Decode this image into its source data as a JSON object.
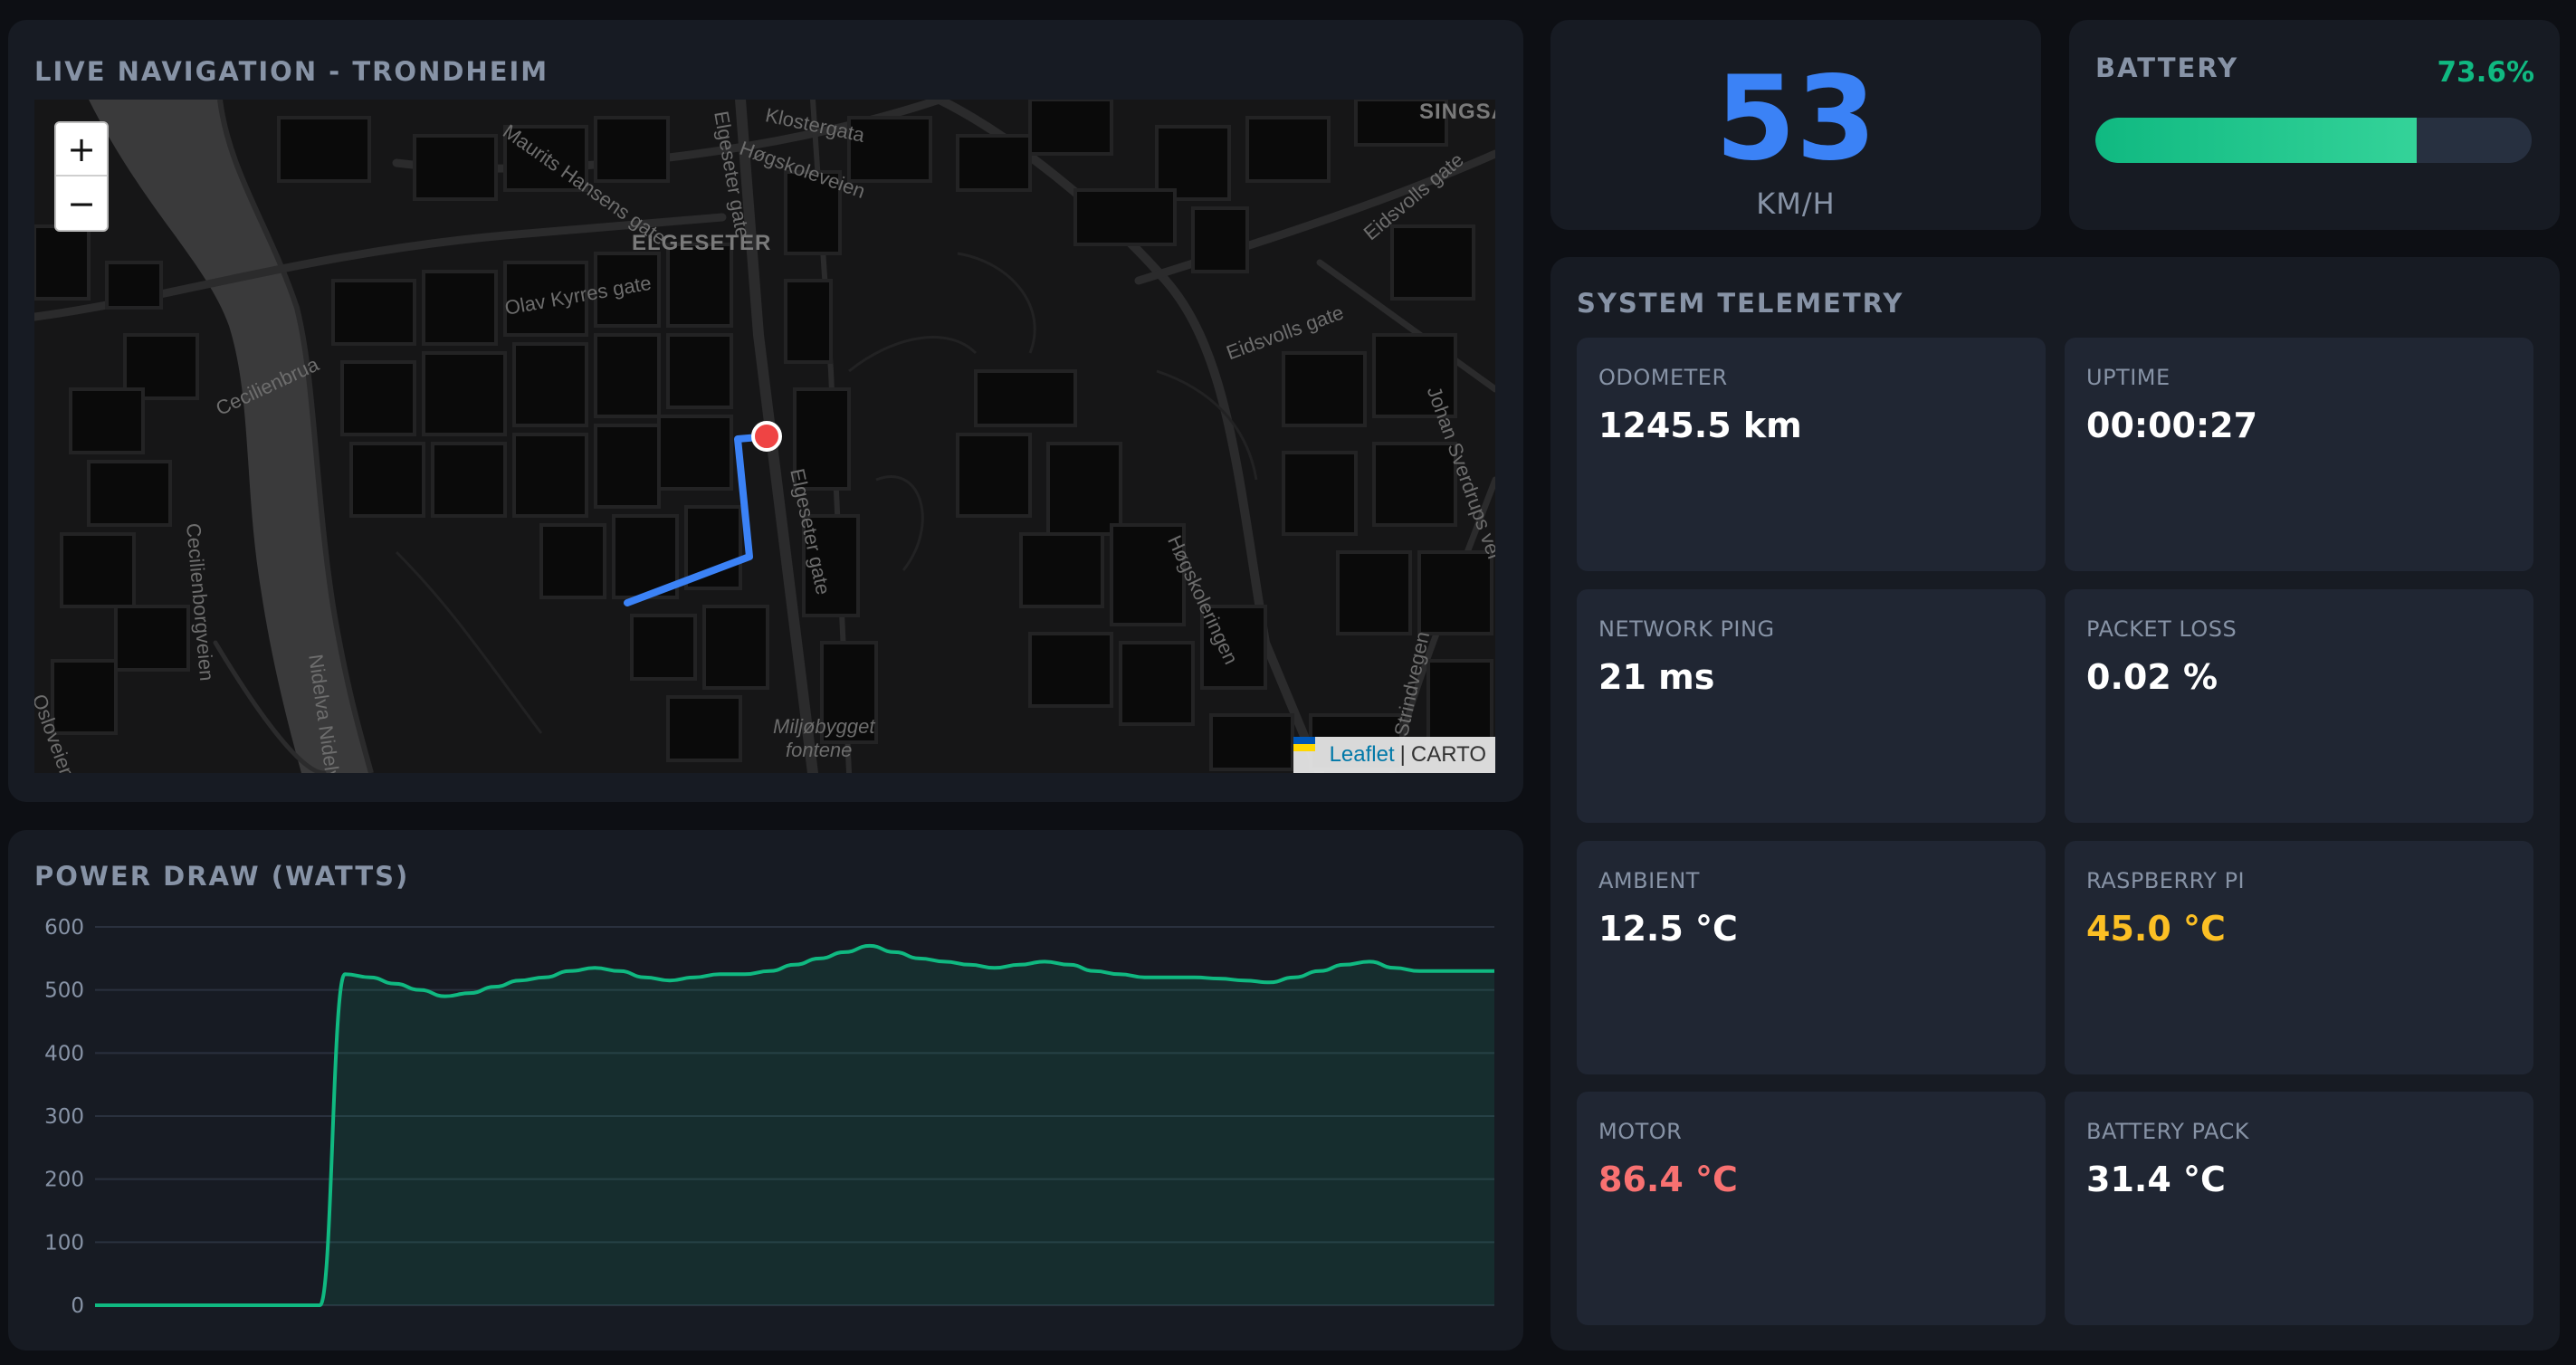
{
  "map": {
    "title": "LIVE NAVIGATION - TRONDHEIM",
    "zoom_in": "+",
    "zoom_out": "−",
    "attribution_link": "Leaflet",
    "attribution_sep": "|",
    "attribution_provider": "CARTO",
    "labels": {
      "elgeseter": "ELGESETER",
      "singsaker": "SINGSA",
      "klostergata": "Klostergata",
      "hogskoleveien": "Høgskoleveien",
      "maurits": "Maurits Hansens gate",
      "elgeseter_gate_top": "Elgeseter gate",
      "elgeseter_gate": "Elgeseter gate",
      "olav": "Olav Kyrres gate",
      "cecilie": "Cecilienbrua",
      "cecilie_vei": "Cecilienborgveien",
      "eidsvolls": "Eidsvolls gate",
      "eidsvolls2": "Eidsvolls gate",
      "johan": "Johan Sverdrups vei",
      "hogskoleringen": "Høgskoleringen",
      "strindvegen": "Strindvegen",
      "osloveien": "Osloveien",
      "nidelva": "Nidelva Nidelva",
      "miljo1": "Miljøbygget",
      "miljo2": "fontene"
    },
    "accent_route": "#3b82f6",
    "accent_marker": "#ef4444"
  },
  "speed": {
    "value": "53",
    "unit": "KM/H",
    "color": "#3b82f6"
  },
  "battery": {
    "title": "BATTERY",
    "percent_label": "73.6%",
    "percent": 73.6,
    "color": "#10b981"
  },
  "telemetry": {
    "title": "SYSTEM TELEMETRY",
    "tiles": [
      {
        "label": "ODOMETER",
        "value": "1245.5 km",
        "color": "#ffffff"
      },
      {
        "label": "UPTIME",
        "value": "00:00:27",
        "color": "#ffffff"
      },
      {
        "label": "NETWORK PING",
        "value": "21 ms",
        "color": "#ffffff"
      },
      {
        "label": "PACKET LOSS",
        "value": "0.02 %",
        "color": "#ffffff"
      },
      {
        "label": "AMBIENT",
        "value": "12.5 °C",
        "color": "#ffffff"
      },
      {
        "label": "RASPBERRY PI",
        "value": "45.0 °C",
        "color": "#fbbf24"
      },
      {
        "label": "MOTOR",
        "value": "86.4 °C",
        "color": "#f87171"
      },
      {
        "label": "BATTERY PACK",
        "value": "31.4 °C",
        "color": "#ffffff"
      }
    ]
  },
  "power": {
    "title": "POWER DRAW (WATTS)"
  },
  "chart_data": {
    "type": "area",
    "title": "POWER DRAW (WATTS)",
    "xlabel": "",
    "ylabel": "",
    "ylim": [
      0,
      600
    ],
    "yticks": [
      0,
      100,
      200,
      300,
      400,
      500,
      600
    ],
    "grid": true,
    "color": "#10b981",
    "series": [
      {
        "values": [
          0,
          0,
          0,
          0,
          0,
          0,
          0,
          0,
          0,
          0,
          525,
          520,
          510,
          500,
          490,
          495,
          505,
          515,
          520,
          530,
          535,
          530,
          520,
          515,
          520,
          525,
          525,
          530,
          540,
          550,
          560,
          570,
          560,
          550,
          545,
          540,
          535,
          540,
          545,
          540,
          530,
          525,
          520,
          520,
          520,
          518,
          515,
          512,
          520,
          530,
          540,
          545,
          535,
          530,
          530,
          530,
          530
        ]
      }
    ]
  }
}
